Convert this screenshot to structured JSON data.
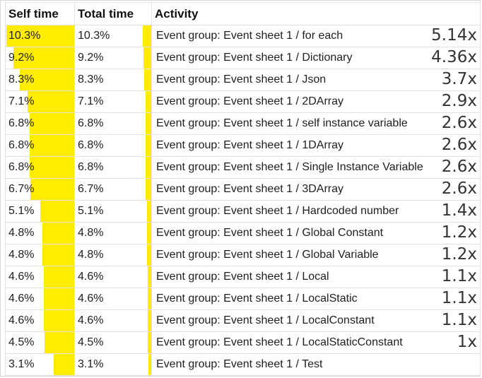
{
  "headers": {
    "self": "Self time",
    "total": "Total time",
    "activity": "Activity"
  },
  "rows": [
    {
      "self": "10.3%",
      "total": "10.3%",
      "activity": "Event group: Event sheet 1 / for each",
      "speed": "5.14x"
    },
    {
      "self": "9.2%",
      "total": "9.2%",
      "activity": "Event group: Event sheet 1 / Dictionary",
      "speed": "4.36x"
    },
    {
      "self": "8.3%",
      "total": "8.3%",
      "activity": "Event group: Event sheet 1 / Json",
      "speed": "3.7x"
    },
    {
      "self": "7.1%",
      "total": "7.1%",
      "activity": "Event group: Event sheet 1 / 2DArray",
      "speed": "2.9x"
    },
    {
      "self": "6.8%",
      "total": "6.8%",
      "activity": "Event group: Event sheet 1 / self instance variable",
      "speed": "2.6x"
    },
    {
      "self": "6.8%",
      "total": "6.8%",
      "activity": "Event group: Event sheet 1 / 1DArray",
      "speed": "2.6x"
    },
    {
      "self": "6.8%",
      "total": "6.8%",
      "activity": "Event group: Event sheet 1 / Single Instance Variable",
      "speed": "2.6x"
    },
    {
      "self": "6.7%",
      "total": "6.7%",
      "activity": "Event group: Event sheet 1 / 3DArray",
      "speed": "2.6x"
    },
    {
      "self": "5.1%",
      "total": "5.1%",
      "activity": "Event group: Event sheet 1 / Hardcoded number",
      "speed": "1.4x"
    },
    {
      "self": "4.8%",
      "total": "4.8%",
      "activity": "Event group: Event sheet 1 / Global Constant",
      "speed": "1.2x"
    },
    {
      "self": "4.8%",
      "total": "4.8%",
      "activity": "Event group: Event sheet 1 / Global Variable",
      "speed": "1.2x"
    },
    {
      "self": "4.6%",
      "total": "4.6%",
      "activity": "Event group: Event sheet 1 / Local",
      "speed": "1.1x"
    },
    {
      "self": "4.6%",
      "total": "4.6%",
      "activity": "Event group: Event sheet 1 / LocalStatic",
      "speed": "1.1x"
    },
    {
      "self": "4.6%",
      "total": "4.6%",
      "activity": "Event group: Event sheet 1 / LocalConstant",
      "speed": "1.1x"
    },
    {
      "self": "4.5%",
      "total": "4.5%",
      "activity": "Event group: Event sheet 1 / LocalStaticConstant",
      "speed": "1x"
    },
    {
      "self": "3.1%",
      "total": "3.1%",
      "activity": "Event group: Event sheet 1 / Test",
      "speed": ""
    }
  ],
  "colors": {
    "bar": "#ffec00",
    "grid": "#e2e2e2"
  }
}
